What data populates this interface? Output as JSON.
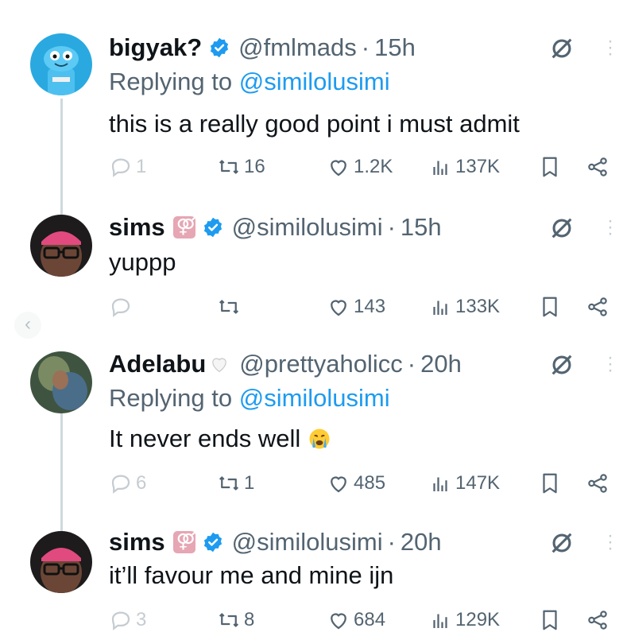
{
  "tweets": [
    {
      "name": "bigyak?",
      "handle": "@fmlmads",
      "time": "15h",
      "replying_prefix": "Replying to ",
      "replying_to": "@similolusimi",
      "text": "this is a really good point i must admit",
      "replies": "1",
      "retweets": "16",
      "likes": "1.2K",
      "views": "137K"
    },
    {
      "name": "sims",
      "handle": "@similolusimi",
      "time": "15h",
      "text": "yuppp",
      "replies": "",
      "retweets": "",
      "likes": "143",
      "views": "133K"
    },
    {
      "name": "Adelabu",
      "handle": "@prettyaholicc",
      "time": "20h",
      "replying_prefix": "Replying to ",
      "replying_to": "@similolusimi",
      "text": "It never ends well",
      "replies": "6",
      "retweets": "1",
      "likes": "485",
      "views": "147K"
    },
    {
      "name": "sims",
      "handle": "@similolusimi",
      "time": "20h",
      "text": "it’ll favour me and mine ijn",
      "replies": "3",
      "retweets": "8",
      "likes": "684",
      "views": "129K"
    }
  ],
  "separator": "·",
  "colors": {
    "text": "#0f1419",
    "muted": "#536471",
    "link": "#1d9bf0",
    "verified": "#1d9bf0",
    "thread_line": "#cfd9de"
  }
}
